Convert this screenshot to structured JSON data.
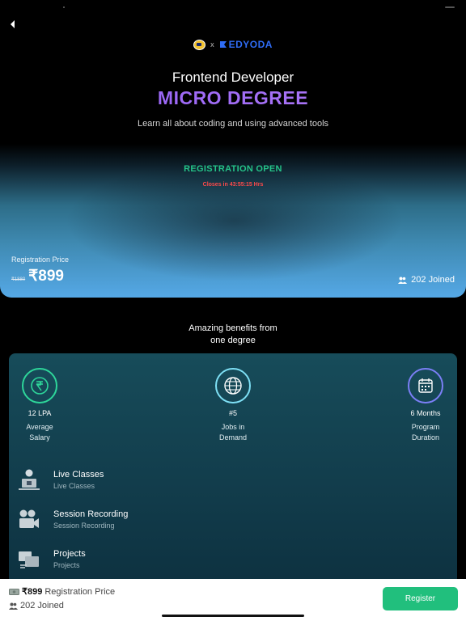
{
  "header": {
    "back_icon": "chevron-left-icon",
    "brand_separator": "x",
    "brand_name": "EDYODA"
  },
  "hero": {
    "role": "Frontend Developer",
    "title": "MICRO DEGREE",
    "subtitle": "Learn all about coding and using advanced tools"
  },
  "registration": {
    "status": "REGISTRATION OPEN",
    "closes": "Closes in 43:55:15 Hrs",
    "price_label": "Registration Price",
    "old_price": "₹1880",
    "price": "₹899",
    "joined": "202 Joined",
    "colors": {
      "status": "#25c489",
      "closes": "#ff4a4a"
    }
  },
  "benefits": {
    "heading_line1": "Amazing benefits from",
    "heading_line2": "one degree",
    "stats": [
      {
        "value": "12 LPA",
        "label_line1": "Average",
        "label_line2": "Salary",
        "icon": "rupee-coins-icon",
        "color": "#2ed69a"
      },
      {
        "value": "#5",
        "label_line1": "Jobs in",
        "label_line2": "Demand",
        "icon": "globe-icon",
        "color": "#7ee0f5"
      },
      {
        "value": "6 Months",
        "label_line1": "Program",
        "label_line2": "Duration",
        "icon": "calendar-icon",
        "color": "#7b7ff6"
      }
    ],
    "features": [
      {
        "title": "Live Classes",
        "subtitle": "Live Classes",
        "icon": "live-class-icon"
      },
      {
        "title": "Session Recording",
        "subtitle": "Session Recording",
        "icon": "video-camera-icon"
      },
      {
        "title": "Projects",
        "subtitle": "Projects",
        "icon": "projects-icon"
      }
    ]
  },
  "bottom_bar": {
    "price": "₹899",
    "price_label": "Registration Price",
    "joined": "202 Joined",
    "register_label": "Register",
    "accent": "#21bf7d"
  }
}
